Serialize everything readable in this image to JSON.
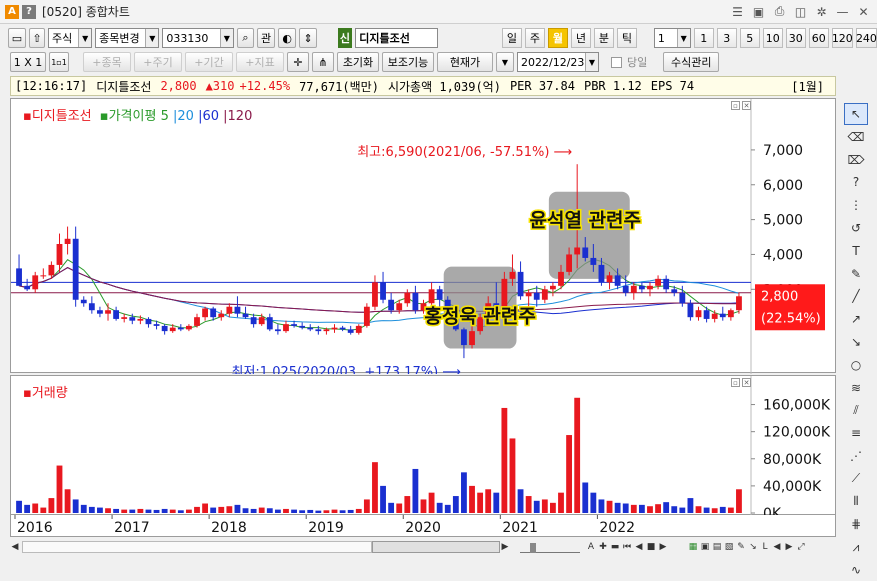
{
  "window": {
    "title": "[0520] 종합차트",
    "app_badge": "A",
    "help_badge": "?"
  },
  "toolbar": {
    "market_type": "주식",
    "stock_change_label": "종목변경",
    "stock_code": "033130",
    "related_label": "관",
    "stock_tag": "신",
    "stock_name": "디지틀조선",
    "periods": [
      "일",
      "주",
      "월",
      "년",
      "분",
      "틱"
    ],
    "active_period": "월",
    "interval_value": "1",
    "intervals": [
      "1",
      "3",
      "5",
      "10",
      "30",
      "60",
      "120",
      "240"
    ]
  },
  "toolbar2": {
    "layout_label": "1 X 1",
    "layout_small": "1▫1",
    "add_item": "+종목",
    "cycle": "+주기",
    "period": "+기간",
    "indicator": "+지표",
    "reset": "초기화",
    "aux": "보조기능",
    "current_price": "현재가",
    "date": "2022/12/23",
    "sameday": "당일",
    "formula": "수식관리"
  },
  "infobar": {
    "time": "[12:16:17]",
    "name": "디지틀조선",
    "price": "2,800",
    "change": "▲310",
    "change_pct": "+12.45%",
    "volume": "77,671(백만)",
    "market_cap": "시가총액 1,039(억)",
    "per": "PER 37.84",
    "pbr": "PBR 1.12",
    "eps": "EPS 74",
    "tab": "[1월]"
  },
  "legend": {
    "name": "디지틀조선",
    "ma_label": "가격이평",
    "ma": [
      "5",
      "20",
      "60",
      "120"
    ],
    "volume_name": "거래량"
  },
  "annotations": {
    "high": "최고:6,590(2021/06, -57.51%)",
    "low": "최저:1,025(2020/03, +173.17%)",
    "box1": "홍정욱 관련주",
    "box2": "윤석열 관련주"
  },
  "colors": {
    "up": "#e8181f",
    "down": "#1a2fd0",
    "ma5": "#2a9a2a",
    "ma20": "#1e8fdc",
    "ma60": "#1a2fd0",
    "ma120": "#8a1a4a"
  },
  "chart_data": {
    "type": "candlestick",
    "x_ticks": [
      "2016",
      "2017",
      "2018",
      "2019",
      "2020",
      "2021",
      "2022"
    ],
    "price_ticks": [
      "7,000",
      "6,000",
      "5,000",
      "4,000",
      "3,000"
    ],
    "price_ylim": [
      1000,
      7600
    ],
    "volume_ticks": [
      "160,000K",
      "120,000K",
      "80,000K",
      "40,000K",
      "0K"
    ],
    "volume_ylim": [
      0,
      180000
    ],
    "current_price_label": "2,800",
    "current_pct_label": "(22.54%)",
    "current_price": 2800,
    "candles": [
      [
        3600,
        4000,
        3400,
        3100
      ],
      [
        3100,
        3300,
        2950,
        3000
      ],
      [
        3000,
        3500,
        2900,
        3400
      ],
      [
        3400,
        3600,
        3300,
        3400
      ],
      [
        3400,
        3800,
        3300,
        3700
      ],
      [
        3700,
        4600,
        3500,
        4300
      ],
      [
        4300,
        4800,
        4000,
        4450
      ],
      [
        4450,
        4800,
        2500,
        2700
      ],
      [
        2700,
        2800,
        2500,
        2600
      ],
      [
        2600,
        2800,
        2300,
        2400
      ],
      [
        2400,
        2500,
        2200,
        2300
      ],
      [
        2300,
        2600,
        2100,
        2400
      ],
      [
        2400,
        2500,
        2100,
        2150
      ],
      [
        2150,
        2300,
        2050,
        2200
      ],
      [
        2200,
        2300,
        2000,
        2100
      ],
      [
        2100,
        2250,
        2000,
        2150
      ],
      [
        2150,
        2200,
        1900,
        2000
      ],
      [
        2000,
        2100,
        1850,
        1950
      ],
      [
        1950,
        2000,
        1700,
        1800
      ],
      [
        1800,
        2000,
        1750,
        1900
      ],
      [
        1900,
        2000,
        1800,
        1850
      ],
      [
        1850,
        2000,
        1800,
        1950
      ],
      [
        1950,
        2300,
        1900,
        2200
      ],
      [
        2200,
        2500,
        2100,
        2450
      ],
      [
        2450,
        2500,
        2100,
        2200
      ],
      [
        2200,
        2400,
        2100,
        2300
      ],
      [
        2300,
        2600,
        2200,
        2500
      ],
      [
        2500,
        2800,
        2200,
        2300
      ],
      [
        2300,
        2500,
        2150,
        2200
      ],
      [
        2200,
        2300,
        1900,
        2000
      ],
      [
        2000,
        2300,
        1950,
        2200
      ],
      [
        2200,
        2300,
        1800,
        1850
      ],
      [
        1850,
        2000,
        1700,
        1800
      ],
      [
        1800,
        2100,
        1750,
        2000
      ],
      [
        2000,
        2100,
        1900,
        1950
      ],
      [
        1950,
        2050,
        1850,
        1900
      ],
      [
        1900,
        2000,
        1800,
        1850
      ],
      [
        1850,
        1950,
        1700,
        1800
      ],
      [
        1800,
        1900,
        1700,
        1850
      ],
      [
        1850,
        2000,
        1750,
        1900
      ],
      [
        1900,
        1950,
        1800,
        1850
      ],
      [
        1850,
        1950,
        1700,
        1750
      ],
      [
        1750,
        2000,
        1700,
        1950
      ],
      [
        1950,
        2600,
        1900,
        2500
      ],
      [
        2500,
        3400,
        2400,
        3200
      ],
      [
        3200,
        3500,
        2600,
        2700
      ],
      [
        2700,
        2900,
        2300,
        2400
      ],
      [
        2400,
        2700,
        2300,
        2600
      ],
      [
        2600,
        3000,
        2500,
        2900
      ],
      [
        2900,
        3100,
        2300,
        2400
      ],
      [
        2400,
        2700,
        2300,
        2600
      ],
      [
        2600,
        3200,
        2500,
        3000
      ],
      [
        3000,
        3100,
        2500,
        2700
      ],
      [
        2700,
        2800,
        2200,
        2300
      ],
      [
        2300,
        2400,
        1800,
        1850
      ],
      [
        1850,
        1900,
        1025,
        1400
      ],
      [
        1400,
        2000,
        1300,
        1800
      ],
      [
        1800,
        2300,
        1700,
        2200
      ],
      [
        2200,
        2800,
        2100,
        2600
      ],
      [
        2600,
        3200,
        2200,
        2400
      ],
      [
        2400,
        3500,
        2300,
        3300
      ],
      [
        3300,
        4000,
        3100,
        3500
      ],
      [
        3500,
        3800,
        2700,
        2800
      ],
      [
        2800,
        3000,
        2500,
        2900
      ],
      [
        2900,
        3100,
        2500,
        2700
      ],
      [
        2700,
        3100,
        2600,
        3000
      ],
      [
        3000,
        3200,
        2800,
        3100
      ],
      [
        3100,
        3700,
        3000,
        3500
      ],
      [
        3500,
        4200,
        3400,
        4000
      ],
      [
        4000,
        6590,
        3600,
        4200
      ],
      [
        4200,
        4500,
        3800,
        3900
      ],
      [
        3900,
        4300,
        3500,
        3700
      ],
      [
        3700,
        3900,
        3100,
        3200
      ],
      [
        3200,
        3500,
        3000,
        3400
      ],
      [
        3400,
        3600,
        3000,
        3100
      ],
      [
        3100,
        3400,
        2800,
        2900
      ],
      [
        2900,
        3200,
        2700,
        3100
      ],
      [
        3100,
        3200,
        2900,
        3000
      ],
      [
        3000,
        3200,
        2800,
        3100
      ],
      [
        3100,
        3400,
        3000,
        3300
      ],
      [
        3300,
        3400,
        2900,
        3000
      ],
      [
        3000,
        3100,
        2800,
        2900
      ],
      [
        2900,
        3100,
        2500,
        2600
      ],
      [
        2600,
        2700,
        2100,
        2200
      ],
      [
        2200,
        2500,
        2100,
        2400
      ],
      [
        2400,
        2500,
        2050,
        2150
      ],
      [
        2150,
        2400,
        2050,
        2300
      ],
      [
        2300,
        2500,
        2100,
        2200
      ],
      [
        2200,
        2450,
        2100,
        2400
      ],
      [
        2400,
        2900,
        2300,
        2800
      ]
    ],
    "volumes": [
      18000,
      12000,
      14000,
      8000,
      22000,
      70000,
      35000,
      20000,
      12000,
      9000,
      8000,
      7000,
      6000,
      5000,
      5000,
      6000,
      5000,
      4500,
      6000,
      5000,
      4000,
      5000,
      9000,
      14000,
      8000,
      9000,
      10000,
      12000,
      7000,
      6000,
      8000,
      7000,
      5000,
      6000,
      5000,
      4000,
      4500,
      3500,
      4000,
      5000,
      4000,
      4500,
      6000,
      20000,
      75000,
      40000,
      15000,
      14000,
      25000,
      65000,
      20000,
      30000,
      15000,
      12000,
      25000,
      60000,
      40000,
      30000,
      35000,
      30000,
      155000,
      110000,
      35000,
      25000,
      18000,
      20000,
      15000,
      30000,
      115000,
      170000,
      45000,
      30000,
      20000,
      18000,
      15000,
      14000,
      12000,
      12000,
      10000,
      13000,
      16000,
      10000,
      8000,
      22000,
      10000,
      8000,
      7000,
      9000,
      8000,
      35000
    ]
  }
}
